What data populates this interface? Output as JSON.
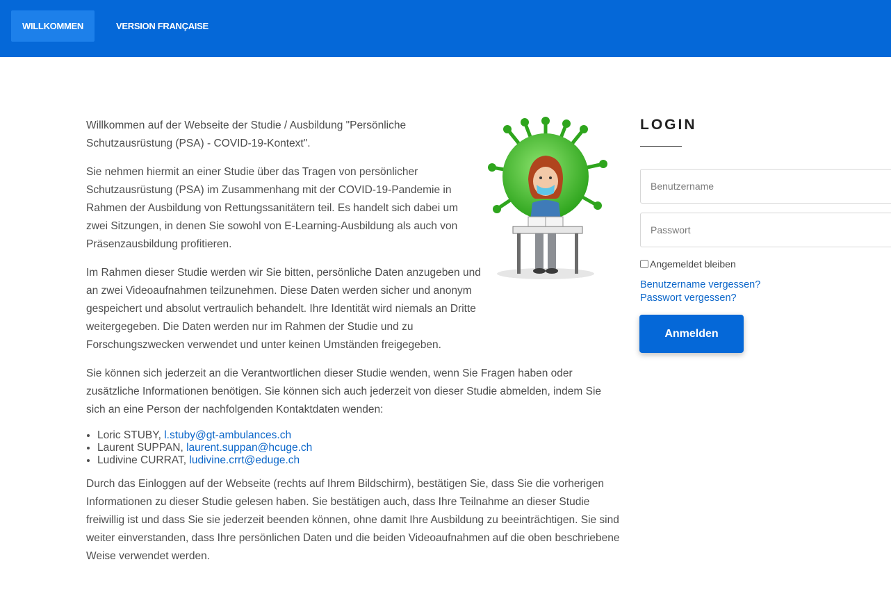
{
  "nav": {
    "tabs": [
      {
        "label": "WILLKOMMEN",
        "active": true
      },
      {
        "label": "VERSION FRANÇAISE",
        "active": false
      }
    ],
    "color": "#0568d8"
  },
  "main": {
    "p1": "Willkommen auf der Webseite der Studie / Ausbildung \"Persönliche Schutzausrüstung (PSA) - COVID-19-Kontext\".",
    "p2": "Sie nehmen hiermit an einer Studie über das Tragen von persönlicher Schutzausrüstung (PSA) im Zusammenhang mit der COVID-19-Pandemie in Rahmen der Ausbildung von Rettungssanitätern teil. Es handelt sich dabei um zwei Sitzungen, in denen Sie sowohl von E-Learning-Ausbildung als auch von Präsenzausbildung profitieren.",
    "p3": "Im Rahmen dieser Studie werden wir Sie bitten, persönliche Daten anzugeben und an zwei Videoaufnahmen teilzunehmen. Diese Daten werden sicher und anonym gespeichert und absolut vertraulich behandelt. Ihre Identität wird niemals an Dritte weitergegeben. Die Daten werden nur im Rahmen der Studie und zu Forschungszwecken verwendet und unter keinen Umständen freigegeben.",
    "p4": "Sie können sich jederzeit an die Verantwortlichen dieser Studie wenden, wenn Sie Fragen haben oder zusätzliche Informationen benötigen. Sie können sich auch jederzeit von dieser Studie abmelden, indem Sie sich an eine Person der nachfolgenden Kontaktdaten wenden:",
    "contacts": [
      {
        "name": "Loric STUBY, ",
        "email": "l.stuby@gt-ambulances.ch"
      },
      {
        "name": "Laurent SUPPAN, ",
        "email": "laurent.suppan@hcuge.ch"
      },
      {
        "name": "Ludivine CURRAT, ",
        "email": "ludivine.crrt@eduge.ch"
      }
    ],
    "p5": "Durch das Einloggen auf der Webseite (rechts auf Ihrem Bildschirm), bestätigen Sie, dass Sie die vorherigen Informationen zu dieser Studie gelesen haben. Sie bestätigen auch, dass Ihre Teilnahme an dieser Studie freiwillig ist und dass Sie sie jederzeit beenden können, ohne damit Ihre Ausbildung zu beeinträchtigen. Sie sind weiter einverstanden, dass Ihre persönlichen Daten und die beiden Videoaufnahmen auf die oben beschriebene Weise verwendet werden."
  },
  "login": {
    "title": "LOGIN",
    "username_placeholder": "Benutzername",
    "username_value": "",
    "password_placeholder": "Passwort",
    "password_value": "",
    "remember_label": "Angemeldet bleiben",
    "remember_checked": false,
    "forgot_username": "Benutzername vergessen?",
    "forgot_password": "Passwort vergessen?",
    "submit_label": "Anmelden"
  },
  "colors": {
    "accent": "#0568d8",
    "link": "#0b66c9",
    "virus": "#3fbf2a"
  },
  "icons": {
    "illustration": "virus-student-reading-illustration"
  }
}
